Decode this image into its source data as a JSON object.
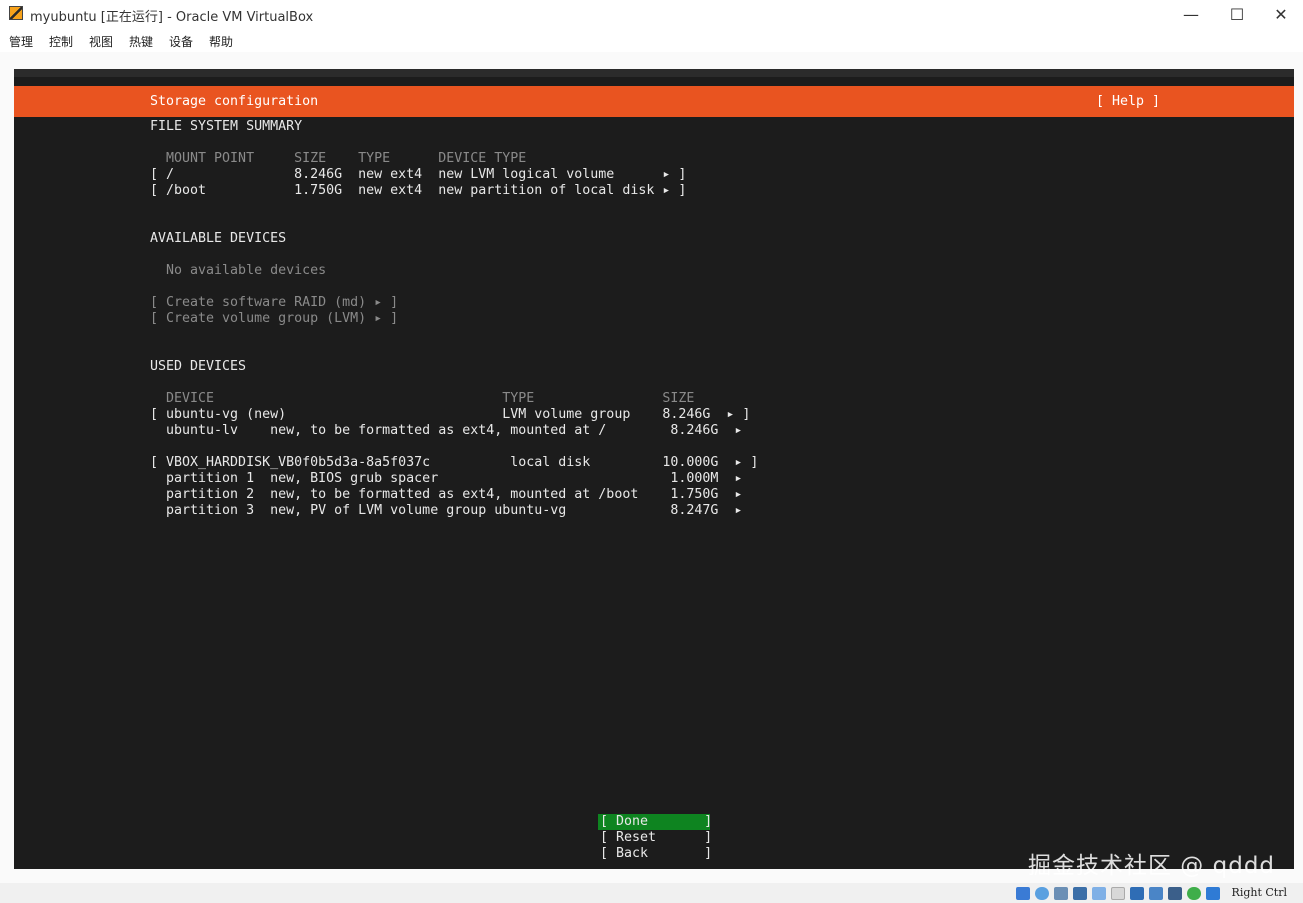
{
  "window": {
    "title": "myubuntu [正在运行] - Oracle VM VirtualBox",
    "minimize": "—",
    "maximize": "☐",
    "close": "✕"
  },
  "menu": [
    "管理",
    "控制",
    "视图",
    "热键",
    "设备",
    "帮助"
  ],
  "header": {
    "title": "Storage configuration",
    "help": "[ Help ]"
  },
  "fs_summary": {
    "heading": "FILE SYSTEM SUMMARY",
    "columns": "  MOUNT POINT     SIZE    TYPE      DEVICE TYPE",
    "rows": [
      "[ /               8.246G  new ext4  new LVM logical volume      ▸ ]",
      "[ /boot           1.750G  new ext4  new partition of local disk ▸ ]"
    ]
  },
  "available": {
    "heading": "AVAILABLE DEVICES",
    "empty": "  No available devices",
    "actions": [
      "[ Create software RAID (md) ▸ ]",
      "[ Create volume group (LVM) ▸ ]"
    ]
  },
  "used": {
    "heading": "USED DEVICES",
    "columns": "  DEVICE                                    TYPE                SIZE",
    "rows": [
      "[ ubuntu-vg (new)                           LVM volume group    8.246G  ▸ ]",
      "  ubuntu-lv    new, to be formatted as ext4, mounted at /        8.246G  ▸",
      "",
      "[ VBOX_HARDDISK_VB0f0b5d3a-8a5f037c          local disk         10.000G  ▸ ]",
      "  partition 1  new, BIOS grub spacer                             1.000M  ▸",
      "  partition 2  new, to be formatted as ext4, mounted at /boot    1.750G  ▸",
      "  partition 3  new, PV of LVM volume group ubuntu-vg             8.247G  ▸"
    ]
  },
  "buttons": {
    "done": "[ Done       ]",
    "reset": "[ Reset      ]",
    "back": "[ Back       ]"
  },
  "statusbar": {
    "hostkey": "Right Ctrl"
  },
  "watermark": "掘金技术社区 @ qddd",
  "colors": {
    "accent": "#e95420",
    "selected": "#0e8420",
    "terminal_bg": "#1c1c1c"
  }
}
